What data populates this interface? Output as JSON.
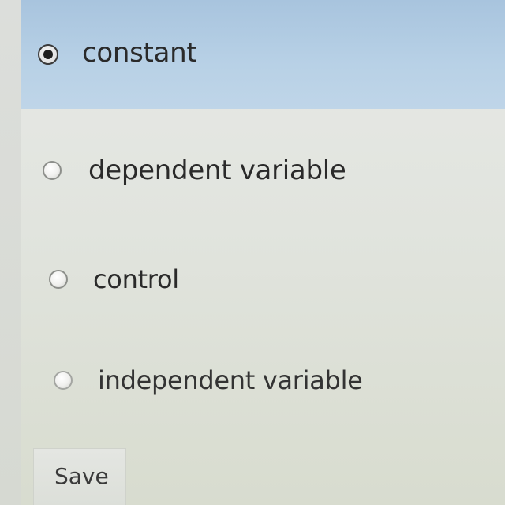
{
  "question": {
    "options": [
      {
        "label": "constant",
        "selected": true
      },
      {
        "label": "dependent variable",
        "selected": false
      },
      {
        "label": "control",
        "selected": false
      },
      {
        "label": "independent variable",
        "selected": false
      }
    ]
  },
  "actions": {
    "save_label": "Save"
  },
  "colors": {
    "selected_background": "#b3cde3",
    "page_background": "#e2e5df",
    "text": "#2a2a2a"
  }
}
